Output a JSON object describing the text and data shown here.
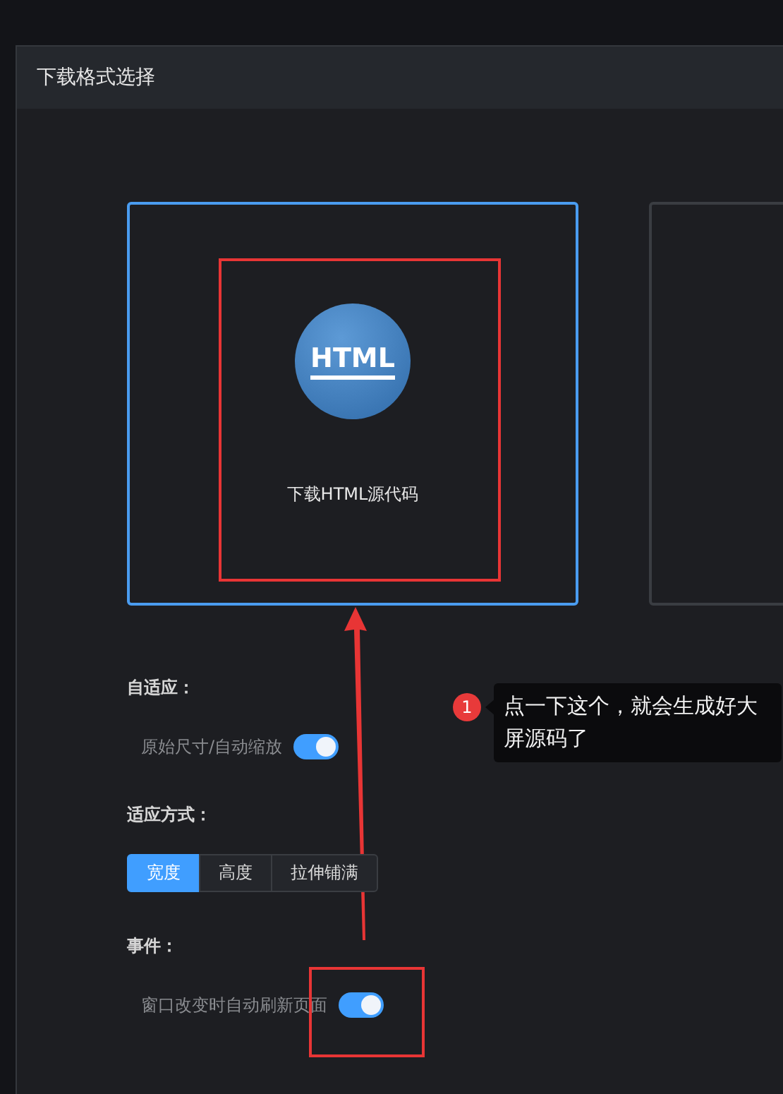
{
  "dialog": {
    "title": "下载格式选择"
  },
  "format_cards": [
    {
      "icon_text": "HTML",
      "label": "下载HTML源代码",
      "selected": true
    },
    {
      "selected": false
    }
  ],
  "sections": [
    {
      "kind": "toggle",
      "heading": "自适应：",
      "label": "原始尺寸/自动缩放",
      "on": true
    },
    {
      "kind": "segmented",
      "heading": "适应方式：",
      "options": [
        {
          "label": "宽度",
          "selected": true
        },
        {
          "label": "高度",
          "selected": false
        },
        {
          "label": "拉伸铺满",
          "selected": false
        }
      ]
    },
    {
      "kind": "toggle",
      "heading": "事件：",
      "label": "窗口改变时自动刷新页面",
      "on": true
    }
  ],
  "annotation": {
    "badge": "1",
    "text": "点一下这个，就会生成好大屏源码了"
  }
}
